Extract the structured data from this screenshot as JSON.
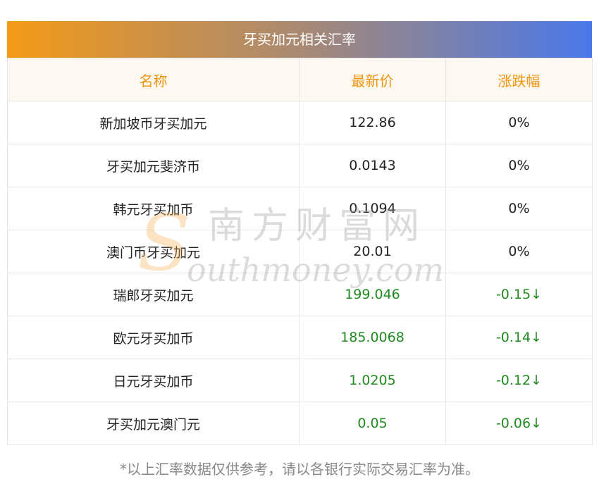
{
  "title": "牙买加元相关汇率",
  "columns": [
    "名称",
    "最新价",
    "涨跌幅"
  ],
  "rows": [
    {
      "name": "新加坡币牙买加元",
      "price": "122.86",
      "change": "0%",
      "trend": "flat"
    },
    {
      "name": "牙买加元斐济币",
      "price": "0.0143",
      "change": "0%",
      "trend": "flat"
    },
    {
      "name": "韩元牙买加币",
      "price": "0.1094",
      "change": "0%",
      "trend": "flat"
    },
    {
      "name": "澳门币牙买加元",
      "price": "20.01",
      "change": "0%",
      "trend": "flat"
    },
    {
      "name": "瑞郎牙买加元",
      "price": "199.046",
      "change": "-0.15↓",
      "trend": "down"
    },
    {
      "name": "欧元牙买加币",
      "price": "185.0068",
      "change": "-0.14↓",
      "trend": "down"
    },
    {
      "name": "日元牙买加币",
      "price": "1.0205",
      "change": "-0.12↓",
      "trend": "down"
    },
    {
      "name": "牙买加元澳门元",
      "price": "0.05",
      "change": "-0.06↓",
      "trend": "down"
    }
  ],
  "footnote": "*以上汇率数据仅供参考，请以各银行实际交易汇率为准。",
  "watermark": {
    "cn": "南方财富网",
    "en_first": "S",
    "en_rest": "outhmoney.com"
  },
  "colors": {
    "header_text": "#f0950f",
    "down": "#1f8a1f",
    "gradient_start": "#f39a17",
    "gradient_end": "#4a78ea"
  }
}
